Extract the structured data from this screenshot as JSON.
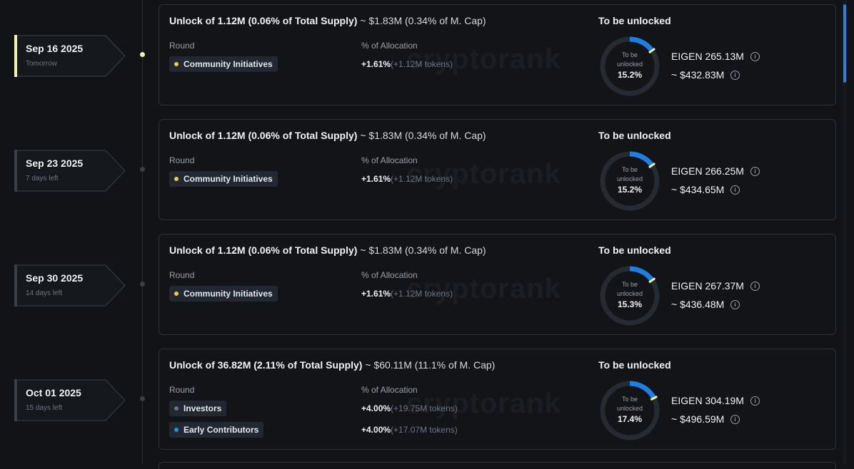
{
  "watermark": "cryptorank",
  "colors": {
    "accent": "#1f7fe0",
    "active_date": "#f2f3a8",
    "ring_track": "#262b31",
    "ring_tip": "#e9f2a8"
  },
  "events": [
    {
      "date": "Sep 16 2025",
      "relative": "Tomorrow",
      "active": true,
      "unlock_amount": "Unlock of 1.12M (0.06% of Total Supply)",
      "unlock_value": "~ $1.83M (0.34% of M. Cap)",
      "round_label": "Round",
      "alloc_label": "% of Allocation",
      "rounds": [
        {
          "name": "Community Initiatives",
          "dot_color": "#f2c94c",
          "pct": "+1.61%",
          "tokens": "(+1.12M tokens)"
        }
      ],
      "tbu_title": "To be unlocked",
      "ring_label": "To be\nunlocked",
      "ring_pct": "15.2%",
      "unlocked_fraction": 0.152,
      "eigen": "EIGEN 265.13M",
      "usd": "~ $432.83M"
    },
    {
      "date": "Sep 23 2025",
      "relative": "7 days left",
      "active": false,
      "unlock_amount": "Unlock of 1.12M (0.06% of Total Supply)",
      "unlock_value": "~ $1.83M (0.34% of M. Cap)",
      "round_label": "Round",
      "alloc_label": "% of Allocation",
      "rounds": [
        {
          "name": "Community Initiatives",
          "dot_color": "#f2c94c",
          "pct": "+1.61%",
          "tokens": "(+1.12M tokens)"
        }
      ],
      "tbu_title": "To be unlocked",
      "ring_label": "To be\nunlocked",
      "ring_pct": "15.2%",
      "unlocked_fraction": 0.152,
      "eigen": "EIGEN 266.25M",
      "usd": "~ $434.65M"
    },
    {
      "date": "Sep 30 2025",
      "relative": "14 days left",
      "active": false,
      "unlock_amount": "Unlock of 1.12M (0.06% of Total Supply)",
      "unlock_value": "~ $1.83M (0.34% of M. Cap)",
      "round_label": "Round",
      "alloc_label": "% of Allocation",
      "rounds": [
        {
          "name": "Community Initiatives",
          "dot_color": "#f2c94c",
          "pct": "+1.61%",
          "tokens": "(+1.12M tokens)"
        }
      ],
      "tbu_title": "To be unlocked",
      "ring_label": "To be\nunlocked",
      "ring_pct": "15.3%",
      "unlocked_fraction": 0.153,
      "eigen": "EIGEN 267.37M",
      "usd": "~ $436.48M"
    },
    {
      "date": "Oct 01 2025",
      "relative": "15 days left",
      "active": false,
      "unlock_amount": "Unlock of 36.82M (2.11% of Total Supply)",
      "unlock_value": "~ $60.11M (11.1% of M. Cap)",
      "round_label": "Round",
      "alloc_label": "% of Allocation",
      "rounds": [
        {
          "name": "Investors",
          "dot_color": "#6b7280",
          "pct": "+4.00%",
          "tokens": "(+19.75M tokens)"
        },
        {
          "name": "Early Contributors",
          "dot_color": "#2d8fd6",
          "pct": "+4.00%",
          "tokens": "(+17.07M tokens)"
        }
      ],
      "tbu_title": "To be unlocked",
      "ring_label": "To be\nunlocked",
      "ring_pct": "17.4%",
      "unlocked_fraction": 0.174,
      "eigen": "EIGEN 304.19M",
      "usd": "~ $496.59M"
    }
  ]
}
